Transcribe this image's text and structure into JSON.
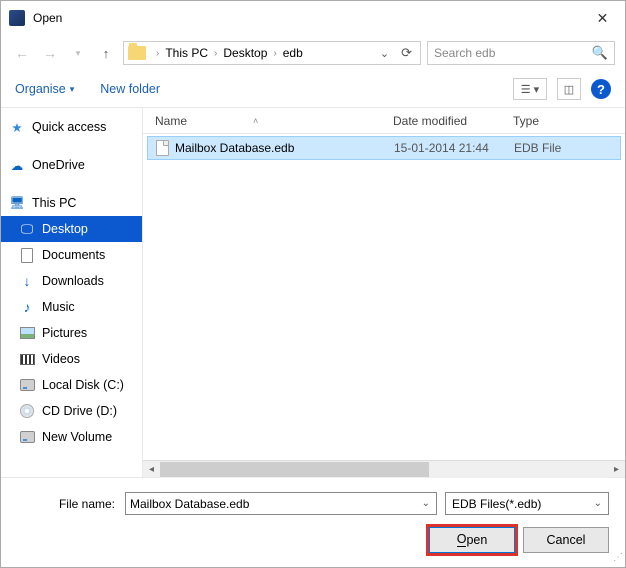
{
  "titlebar": {
    "title": "Open"
  },
  "breadcrumb": {
    "root": "This PC",
    "p1": "Desktop",
    "p2": "edb"
  },
  "search": {
    "placeholder": "Search edb"
  },
  "toolbar": {
    "organise": "Organise",
    "newfolder": "New folder"
  },
  "sidebar": {
    "quickaccess": "Quick access",
    "onedrive": "OneDrive",
    "thispc": "This PC",
    "desktop": "Desktop",
    "documents": "Documents",
    "downloads": "Downloads",
    "music": "Music",
    "pictures": "Pictures",
    "videos": "Videos",
    "localdisk": "Local Disk (C:)",
    "cddrive": "CD Drive (D:)",
    "newvolume": "New Volume"
  },
  "columns": {
    "name": "Name",
    "date": "Date modified",
    "type": "Type"
  },
  "file": {
    "name": "Mailbox Database.edb",
    "date": "15-01-2014 21:44",
    "type": "EDB File"
  },
  "bottom": {
    "label": "File name:",
    "value": "Mailbox Database.edb",
    "filter": "EDB Files(*.edb)",
    "open_u": "O",
    "open_rest": "pen",
    "cancel": "Cancel"
  }
}
